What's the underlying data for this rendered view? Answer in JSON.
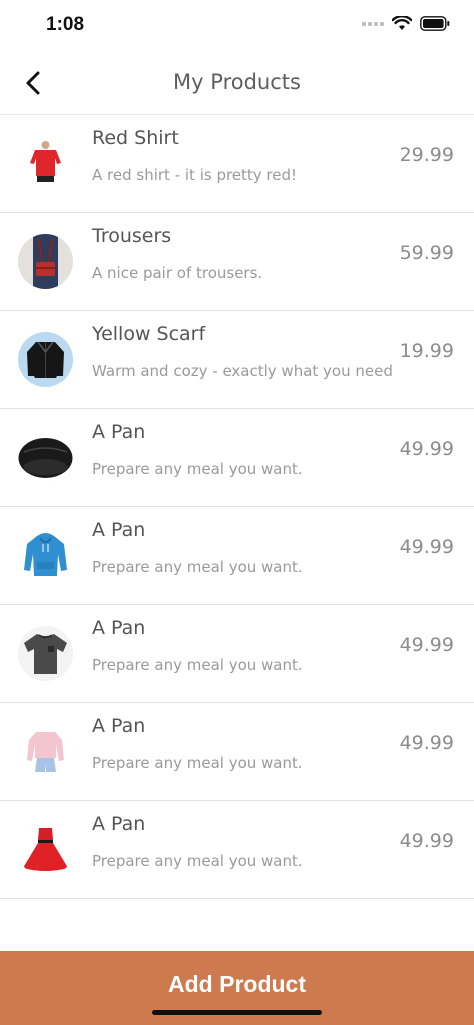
{
  "status_bar": {
    "time": "1:08"
  },
  "header": {
    "title": "My Products",
    "back_icon": "chevron-left-icon"
  },
  "products": [
    {
      "title": "Red Shirt",
      "description": "A red shirt - it is pretty red!",
      "price": "29.99",
      "image": "red-shirt"
    },
    {
      "title": "Trousers",
      "description": "A nice pair of trousers.",
      "price": "59.99",
      "image": "red-bag"
    },
    {
      "title": "Yellow Scarf",
      "description": "Warm and cozy - exactly what you need",
      "price": "19.99",
      "image": "leather-jacket"
    },
    {
      "title": "A Pan",
      "description": "Prepare any meal you want.",
      "price": "49.99",
      "image": "black-beanie"
    },
    {
      "title": "A Pan",
      "description": "Prepare any meal you want.",
      "price": "49.99",
      "image": "blue-hoodie"
    },
    {
      "title": "A Pan",
      "description": "Prepare any meal you want.",
      "price": "49.99",
      "image": "grey-tshirt"
    },
    {
      "title": "A Pan",
      "description": "Prepare any meal you want.",
      "price": "49.99",
      "image": "pink-sweater"
    },
    {
      "title": "A Pan",
      "description": "Prepare any meal you want.",
      "price": "49.99",
      "image": "red-dress"
    }
  ],
  "footer": {
    "add_button_label": "Add Product"
  },
  "colors": {
    "accent": "#cd7b4e"
  }
}
